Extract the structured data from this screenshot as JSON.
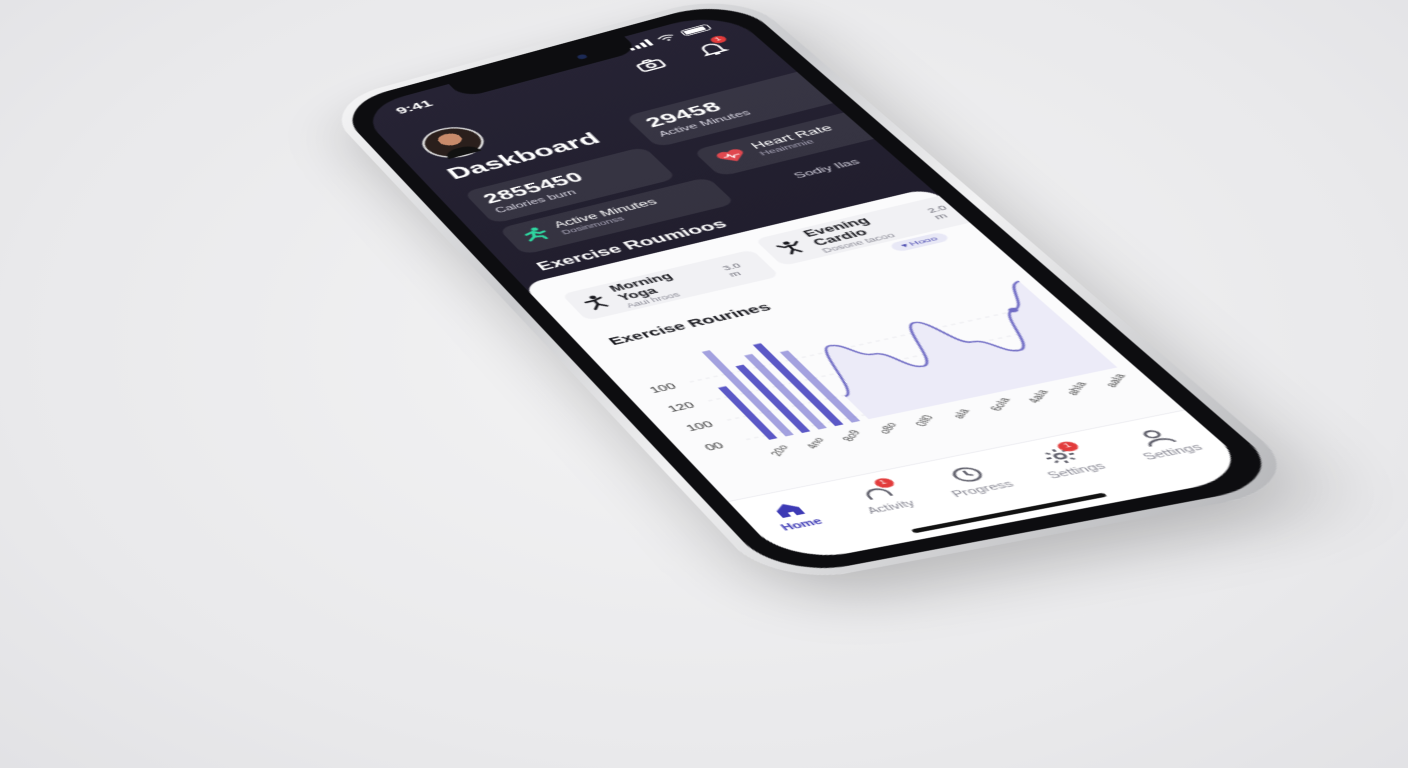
{
  "status": {
    "time": "9:41"
  },
  "header": {
    "title": "Daskboard",
    "notification_badge": "1"
  },
  "stats": {
    "calories": {
      "value": "2855450",
      "label": "Calories burn"
    },
    "active_minutes": {
      "value": "29458",
      "label": "Active Minutes"
    },
    "active_minutes_row": {
      "title": "Active Minutes",
      "subtitle": "Dosinmonss"
    },
    "heart_rate": {
      "title": "Heart Rate",
      "subtitle": "Heaimmie"
    },
    "sodiy_label": "Sodiy Ilas"
  },
  "routines": {
    "section_title": "Exercise Roumioos",
    "items": [
      {
        "name": "Morning Yoga",
        "sub": "Aaui hroos",
        "duration": "3.0 m"
      },
      {
        "name": "Evening Cardio",
        "sub": "Dosone tacoo",
        "duration": "2.0 m"
      }
    ],
    "pill": "▾ Hooo"
  },
  "chart_data": {
    "type": "line",
    "title": "Exercise Rourines",
    "yticks": [
      "100",
      "120",
      "100",
      "00"
    ],
    "bars": [
      70,
      115,
      90,
      100,
      110,
      95
    ],
    "line": [
      30,
      90,
      70,
      45,
      95,
      60,
      40,
      85,
      115
    ],
    "x_tick_labels": [
      "20o",
      "4no",
      "8o9",
      "o8o",
      "0Il0",
      "aIa",
      "6oIa",
      "4aIa",
      "ahIa",
      "aaIa"
    ],
    "colors": {
      "bar": "#5b58c6",
      "line": "#6f6bc4",
      "fill": "#ecebf8"
    }
  },
  "tabbar": {
    "items": [
      {
        "label": "Home",
        "icon": "home-icon",
        "active": true
      },
      {
        "label": "Activity",
        "icon": "activity-icon",
        "badge": "1"
      },
      {
        "label": "Progress",
        "icon": "progress-icon"
      },
      {
        "label": "Settings",
        "icon": "gear-icon",
        "badge": "1"
      },
      {
        "label": "Settings",
        "icon": "person-icon"
      }
    ]
  },
  "colors": {
    "accent": "#3d3ab5",
    "bg_dark": "#221f30",
    "badge": "#e23b3b",
    "heart": "#e0484f",
    "figure_green": "#2fd6a0"
  }
}
